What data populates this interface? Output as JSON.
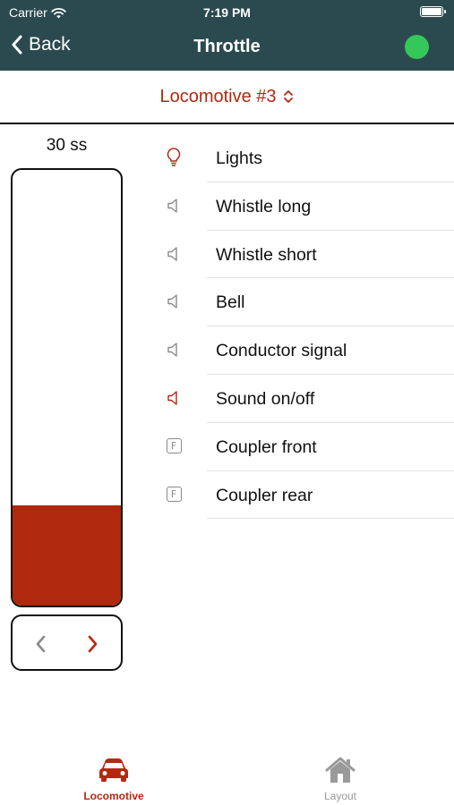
{
  "status_bar": {
    "carrier": "Carrier",
    "time": "7:19 PM"
  },
  "nav": {
    "back_label": "Back",
    "title": "Throttle",
    "connection_color": "#34c759"
  },
  "locomotive_selector": {
    "label": "Locomotive #3"
  },
  "throttle": {
    "speed_label": "30 ss",
    "level_fraction": 0.23,
    "fill_color": "#b0280e"
  },
  "functions": [
    {
      "label": "Lights",
      "icon": "lightbulb-icon",
      "active": true
    },
    {
      "label": "Whistle long",
      "icon": "speaker-icon",
      "active": false
    },
    {
      "label": "Whistle short",
      "icon": "speaker-icon",
      "active": false
    },
    {
      "label": "Bell",
      "icon": "speaker-icon",
      "active": false
    },
    {
      "label": "Conductor signal",
      "icon": "speaker-icon",
      "active": false
    },
    {
      "label": "Sound on/off",
      "icon": "speaker-icon",
      "active": true
    },
    {
      "label": "Coupler front",
      "icon": "function-f-icon",
      "active": false
    },
    {
      "label": "Coupler rear",
      "icon": "function-f-icon",
      "active": false
    }
  ],
  "tabs": [
    {
      "label": "Locomotive",
      "icon": "car-icon",
      "selected": true
    },
    {
      "label": "Layout",
      "icon": "house-icon",
      "selected": false
    }
  ],
  "colors": {
    "accent": "#b3280f",
    "header": "#2b4a4f",
    "inactive": "#8a8a8a"
  }
}
